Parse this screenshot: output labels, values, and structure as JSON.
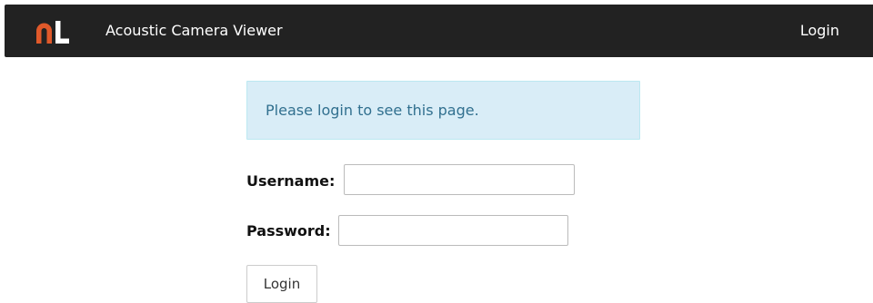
{
  "navbar": {
    "logo_icon": "brand-logo-icon",
    "logo_colors": [
      "#e0592a",
      "#ffffff"
    ],
    "brand_title": "Acoustic Camera Viewer",
    "login_link": "Login"
  },
  "alert": {
    "message": "Please login to see this page."
  },
  "form": {
    "username_label": "Username:",
    "username_value": "",
    "password_label": "Password:",
    "password_value": "",
    "submit_label": "Login"
  }
}
